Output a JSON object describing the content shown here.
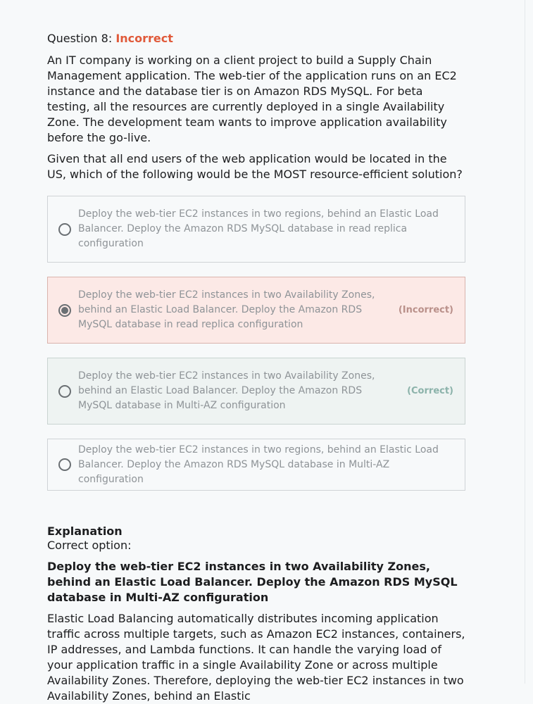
{
  "question": {
    "number_label": "Question 8:",
    "status": "Incorrect",
    "text_paragraphs": [
      "An IT company is working on a client project to build a Supply Chain Management application. The web-tier of the application runs on an EC2 instance and the database tier is on Amazon RDS MySQL. For beta testing, all the resources are currently deployed in a single Availability Zone. The development team wants to improve application availability before the go-live.",
      "Given that all end users of the web application would be located in the US, which of the following would be the MOST resource-efficient solution?"
    ]
  },
  "options": [
    {
      "text": "Deploy the web-tier EC2 instances in two regions, behind an Elastic Load Balancer. Deploy the Amazon RDS MySQL database in read replica configuration",
      "tag": "",
      "selected": false
    },
    {
      "text": "Deploy the web-tier EC2 instances in two Availability Zones, behind an Elastic Load Balancer. Deploy the Amazon RDS MySQL database in read replica configuration",
      "tag": "(Incorrect)",
      "selected": true
    },
    {
      "text": "Deploy the web-tier EC2 instances in two Availability Zones, behind an Elastic Load Balancer. Deploy the Amazon RDS MySQL database in Multi-AZ configuration",
      "tag": "(Correct)",
      "selected": false
    },
    {
      "text": "Deploy the web-tier EC2 instances in two regions, behind an Elastic Load Balancer. Deploy the Amazon RDS MySQL database in Multi-AZ configuration",
      "tag": "",
      "selected": false
    }
  ],
  "explanation": {
    "heading": "Explanation",
    "subheading": "Correct option:",
    "correct_option": "Deploy the web-tier EC2 instances in two Availability Zones, behind an Elastic Load Balancer. Deploy the Amazon RDS MySQL database in Multi-AZ configuration",
    "body": "Elastic Load Balancing automatically distributes incoming application traffic across multiple targets, such as Amazon EC2 instances, containers, IP addresses, and Lambda functions. It can handle the varying load of your application traffic in a single Availability Zone or across multiple Availability Zones. Therefore, deploying the web-tier EC2 instances in two Availability Zones, behind an Elastic"
  },
  "colors": {
    "incorrect_accent": "#e05a3a",
    "incorrect_bg": "#fce9e6",
    "correct_bg": "#eef3f2"
  }
}
